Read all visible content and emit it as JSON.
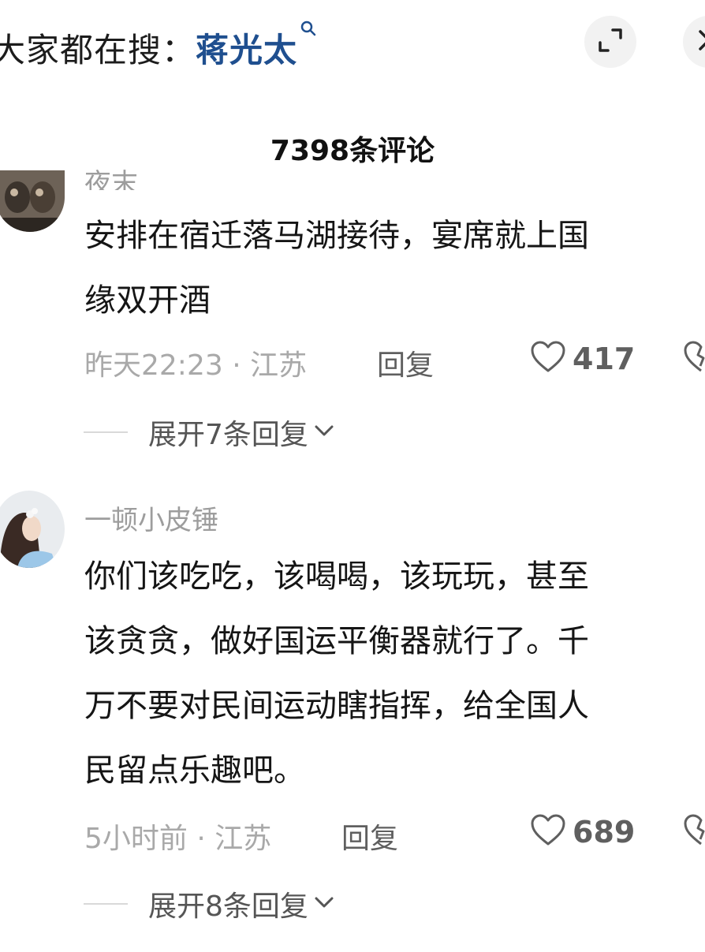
{
  "header": {
    "search_prefix": "大家都在搜：",
    "search_term": "蒋光太",
    "icons": [
      "search-icon",
      "expand-icon",
      "close-icon"
    ]
  },
  "comments_title": "7398条评论",
  "comments": [
    {
      "username": "夜末",
      "text_line1": "安排在宿迁落马湖接待，宴席就上国",
      "text_line2": "缘双开酒",
      "meta": "昨天22:23 · 江苏",
      "reply_label": "回复",
      "likes": "417",
      "expand_label": "展开7条回复"
    },
    {
      "username": "一顿小皮锤",
      "text_line1": "你们该吃吃，该喝喝，该玩玩，甚至",
      "text_line2": "该贪贪，做好国运平衡器就行了。千",
      "text_line3": "万不要对民间运动瞎指挥，给全国人",
      "text_line4": "民留点乐趣吧。",
      "meta": "5小时前 · 江苏",
      "reply_label": "回复",
      "likes": "689",
      "expand_label": "展开8条回复"
    }
  ],
  "colors": {
    "search_term": "#1f4f8f",
    "meta_gray": "#a9a9a9",
    "text": "#151515",
    "button_bg": "#f2f2f2"
  }
}
